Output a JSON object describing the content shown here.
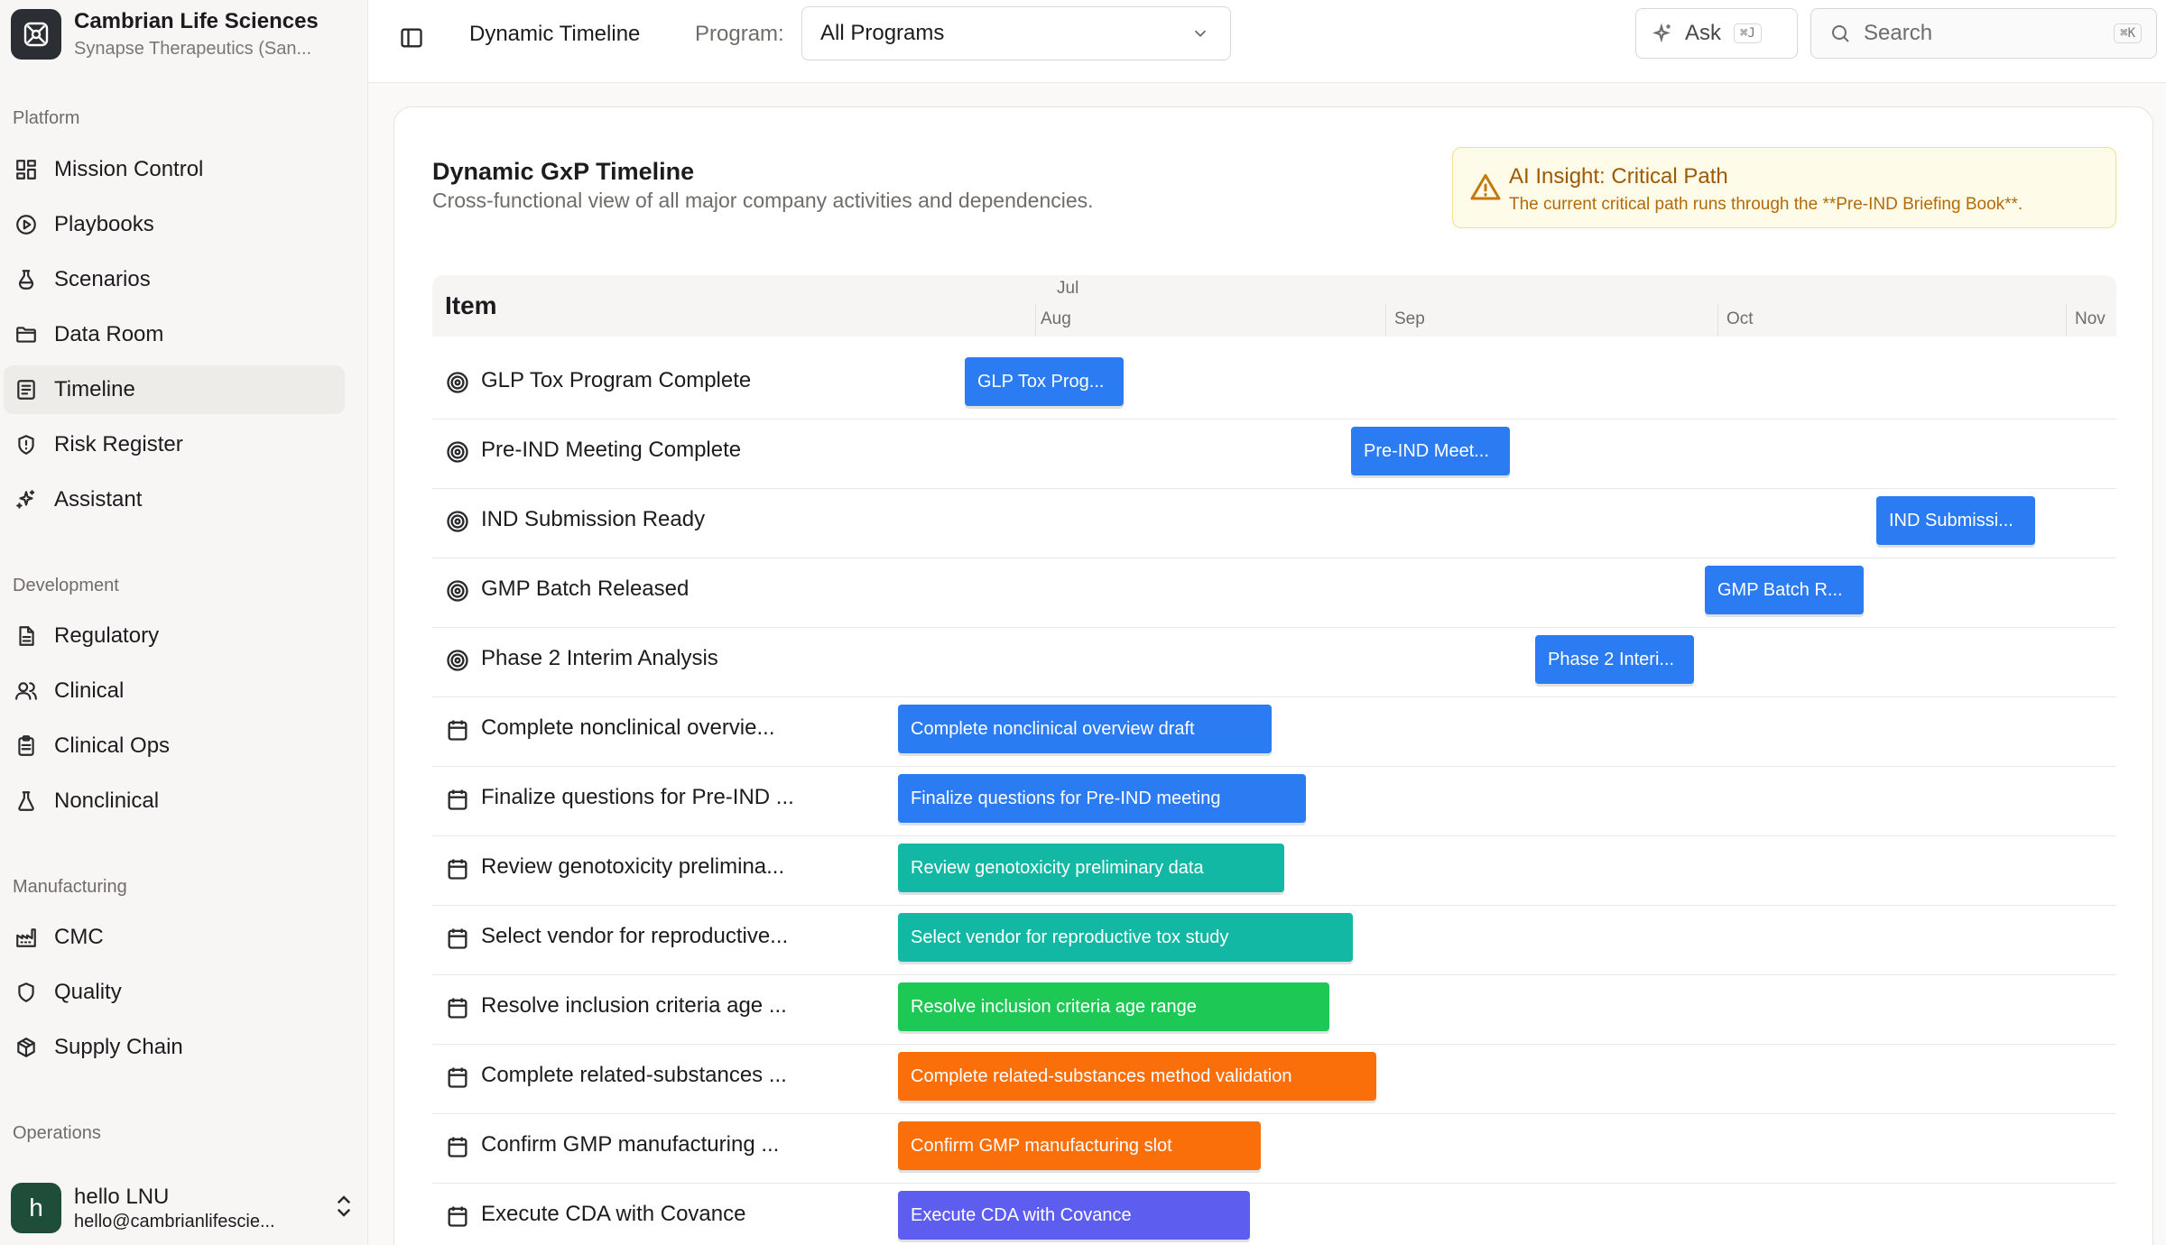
{
  "org": {
    "name": "Cambrian Life Sciences",
    "subtitle": "Synapse Therapeutics (San..."
  },
  "sidebar": {
    "sections": [
      {
        "title": "Platform",
        "items": [
          {
            "label": "Mission Control",
            "icon": "grid-icon"
          },
          {
            "label": "Playbooks",
            "icon": "play-circle-icon"
          },
          {
            "label": "Scenarios",
            "icon": "flask-icon"
          },
          {
            "label": "Data Room",
            "icon": "folder-icon"
          },
          {
            "label": "Timeline",
            "icon": "list-icon",
            "active": true
          },
          {
            "label": "Risk Register",
            "icon": "shield-alert-icon"
          },
          {
            "label": "Assistant",
            "icon": "sparkles-icon"
          }
        ]
      },
      {
        "title": "Development",
        "items": [
          {
            "label": "Regulatory",
            "icon": "document-icon"
          },
          {
            "label": "Clinical",
            "icon": "users-icon"
          },
          {
            "label": "Clinical Ops",
            "icon": "clipboard-icon"
          },
          {
            "label": "Nonclinical",
            "icon": "beaker-icon"
          }
        ]
      },
      {
        "title": "Manufacturing",
        "items": [
          {
            "label": "CMC",
            "icon": "factory-icon"
          },
          {
            "label": "Quality",
            "icon": "shield-icon"
          },
          {
            "label": "Supply Chain",
            "icon": "package-icon"
          }
        ]
      },
      {
        "title": "Operations",
        "items": []
      }
    ]
  },
  "user": {
    "initial": "h",
    "name": "hello LNU",
    "email": "hello@cambrianlifescie..."
  },
  "header": {
    "breadcrumb": "Dynamic Timeline",
    "program_label": "Program:",
    "program_value": "All Programs",
    "ask_label": "Ask",
    "ask_shortcut": "⌘J",
    "search_placeholder": "Search",
    "search_shortcut": "⌘K"
  },
  "main": {
    "title": "Dynamic GxP Timeline",
    "subtitle": "Cross-functional view of all major company activities and dependencies.",
    "insight": {
      "title": "AI Insight: Critical Path",
      "body": "The current critical path runs through the **Pre-IND Briefing Book**."
    },
    "item_header": "Item",
    "ticks": [
      "Jul",
      "Aug",
      "Sep",
      "Oct",
      "Nov"
    ],
    "rows": [
      {
        "label": "GLP Tox Program Complete",
        "type": "milestone",
        "bar": "GLP Tox Prog...",
        "color": "#2b7bf2"
      },
      {
        "label": "Pre-IND Meeting Complete",
        "type": "milestone",
        "bar": "Pre-IND Meet...",
        "color": "#2b7bf2"
      },
      {
        "label": "IND Submission Ready",
        "type": "milestone",
        "bar": "IND Submissi...",
        "color": "#2b7bf2"
      },
      {
        "label": "GMP Batch Released",
        "type": "milestone",
        "bar": "GMP Batch R...",
        "color": "#2b7bf2"
      },
      {
        "label": "Phase 2 Interim Analysis",
        "type": "milestone",
        "bar": "Phase 2 Interi...",
        "color": "#2b7bf2"
      },
      {
        "label": "Complete nonclinical overvie...",
        "type": "task",
        "bar": "Complete nonclinical overview draft",
        "color": "#2b7bf2"
      },
      {
        "label": "Finalize questions for Pre-IND ...",
        "type": "task",
        "bar": "Finalize questions for Pre-IND meeting",
        "color": "#2b7bf2"
      },
      {
        "label": "Review genotoxicity prelimina...",
        "type": "task",
        "bar": "Review genotoxicity preliminary data",
        "color": "#12b8a4"
      },
      {
        "label": "Select vendor for reproductive...",
        "type": "task",
        "bar": "Select vendor for reproductive tox study",
        "color": "#12b8a4"
      },
      {
        "label": "Resolve inclusion criteria age ...",
        "type": "task",
        "bar": "Resolve inclusion criteria age range",
        "color": "#1dc954"
      },
      {
        "label": "Complete related-substances ...",
        "type": "task",
        "bar": "Complete related-substances method validation",
        "color": "#fb6f0a"
      },
      {
        "label": "Confirm GMP manufacturing ...",
        "type": "task",
        "bar": "Confirm GMP manufacturing slot",
        "color": "#fb6f0a"
      },
      {
        "label": "Execute CDA with Covance",
        "type": "task",
        "bar": "Execute CDA with Covance",
        "color": "#5d5ef0"
      }
    ]
  }
}
